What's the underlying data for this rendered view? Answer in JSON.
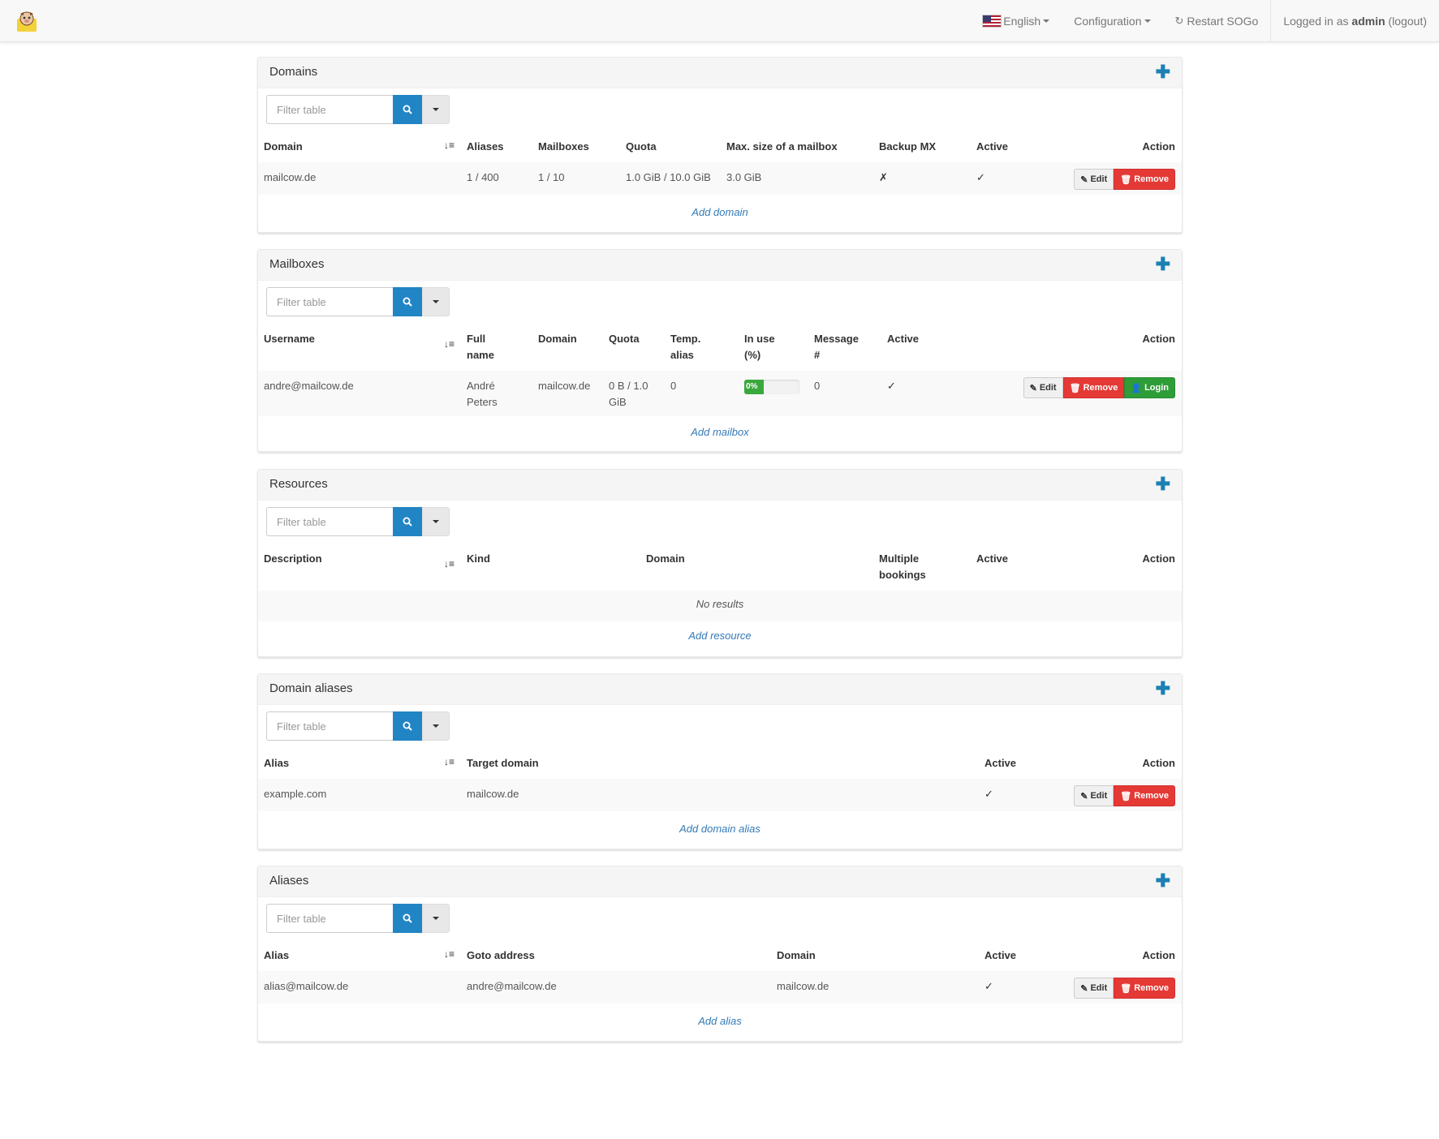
{
  "nav": {
    "language": "English",
    "configuration": "Configuration",
    "restart": "Restart SOGo",
    "logged_prefix": "Logged in as",
    "user": "admin",
    "logout": "(logout)"
  },
  "filter_placeholder": "Filter table",
  "domains": {
    "title": "Domains",
    "headers": [
      "Domain",
      "Aliases",
      "Mailboxes",
      "Quota",
      "Max. size of a mailbox",
      "Backup MX",
      "Active",
      "Action"
    ],
    "row": {
      "domain": "mailcow.de",
      "aliases": "1 / 400",
      "mailboxes": "1 / 10",
      "quota": "1.0 GiB / 10.0 GiB",
      "max_size": "3.0 GiB",
      "backup_mx": "✗",
      "active": "✓"
    },
    "add": "Add domain"
  },
  "mailboxes": {
    "title": "Mailboxes",
    "headers": {
      "username": "Username",
      "full_name_1": "Full",
      "full_name_2": "name",
      "domain": "Domain",
      "quota": "Quota",
      "temp_1": "Temp.",
      "temp_2": "alias",
      "inuse_1": "In use",
      "inuse_2": "(%)",
      "msg_1": "Message",
      "msg_2": "#",
      "active": "Active",
      "action": "Action"
    },
    "row": {
      "username": "andre@mailcow.de",
      "name_1": "André",
      "name_2": "Peters",
      "domain": "mailcow.de",
      "quota_1": "0 B / 1.0",
      "quota_2": "GiB",
      "temp": "0",
      "inuse_label": "0%",
      "inuse_value": 0,
      "messages": "0",
      "active": "✓"
    },
    "add": "Add mailbox"
  },
  "resources": {
    "title": "Resources",
    "headers": {
      "description": "Description",
      "kind": "Kind",
      "domain": "Domain",
      "multi_1": "Multiple",
      "multi_2": "bookings",
      "active": "Active",
      "action": "Action"
    },
    "empty": "No results",
    "add": "Add resource"
  },
  "domain_aliases": {
    "title": "Domain aliases",
    "headers": {
      "alias": "Alias",
      "target": "Target domain",
      "active": "Active",
      "action": "Action"
    },
    "row": {
      "alias": "example.com",
      "target": "mailcow.de",
      "active": "✓"
    },
    "add": "Add domain alias"
  },
  "aliases": {
    "title": "Aliases",
    "headers": {
      "alias": "Alias",
      "goto": "Goto address",
      "domain": "Domain",
      "active": "Active",
      "action": "Action"
    },
    "row": {
      "alias": "alias@mailcow.de",
      "goto": "andre@mailcow.de",
      "domain": "mailcow.de",
      "active": "✓"
    },
    "add": "Add alias"
  },
  "buttons": {
    "edit": "Edit",
    "remove": "Remove",
    "login": "Login"
  },
  "icons": {
    "plus": "plus-icon",
    "search": "search-icon",
    "sort": "sort-alpha-icon",
    "edit": "pencil-icon",
    "remove": "trash-icon",
    "login": "user-icon",
    "refresh": "refresh-icon"
  },
  "colors": {
    "accent": "#2185c5",
    "danger": "#e53935",
    "success": "#2e9d38",
    "link": "#337ab7"
  }
}
